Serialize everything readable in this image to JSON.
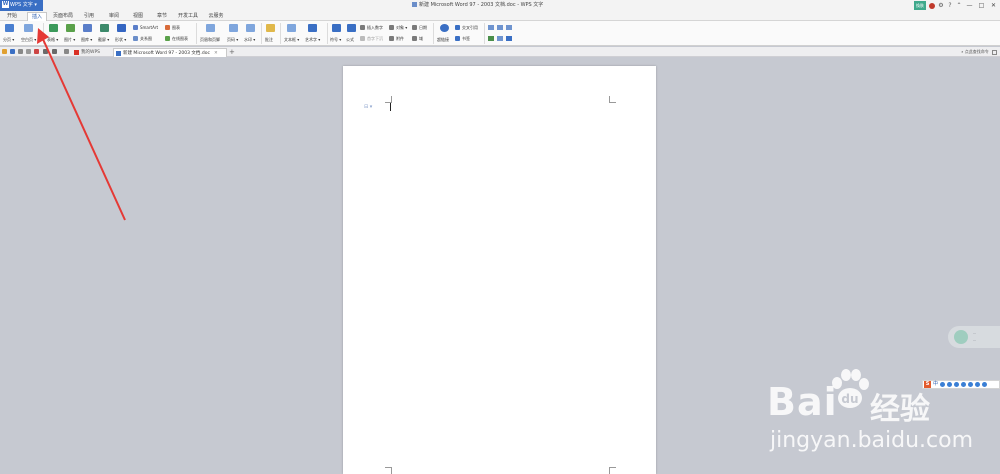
{
  "app": {
    "menu_label": "WPS 文字",
    "logo_letter": "W"
  },
  "window": {
    "title": "新建 Microsoft Word 97 - 2003 文档.doc - WPS 文字",
    "skin_label": "換肤",
    "controls": [
      "—",
      "□",
      "✕"
    ]
  },
  "ribbon_tabs": [
    {
      "label": "开始",
      "active": false
    },
    {
      "label": "插入",
      "active": true
    },
    {
      "label": "页面布局",
      "active": false
    },
    {
      "label": "引用",
      "active": false
    },
    {
      "label": "审阅",
      "active": false
    },
    {
      "label": "视图",
      "active": false
    },
    {
      "label": "章节",
      "active": false
    },
    {
      "label": "开发工具",
      "active": false
    },
    {
      "label": "云服务",
      "active": false
    }
  ],
  "ribbon": {
    "groups": [
      {
        "label": "分页 ▾",
        "icon": "page-break-icon",
        "color": "#4a7fd0"
      },
      {
        "label": "空白页 ▾",
        "icon": "blank-page-icon",
        "color": "#7fa6dd"
      },
      {
        "label": "表格 ▾",
        "icon": "table-icon",
        "color": "#3c9a5b"
      },
      {
        "label": "图片 ▾",
        "icon": "picture-icon",
        "color": "#5aa14a"
      },
      {
        "label": "图库 ▾",
        "icon": "gallery-icon",
        "color": "#5a7ec9"
      },
      {
        "label": "截屏 ▾",
        "icon": "screenshot-icon",
        "color": "#3d8a6b"
      },
      {
        "label": "形状 ▾",
        "icon": "shape-icon",
        "color": "#3566c2"
      }
    ],
    "small_items": [
      {
        "label": "SmartArt",
        "icon": "smartart-icon"
      },
      {
        "label": "图表",
        "icon": "chart-icon"
      },
      {
        "label": "关系图",
        "icon": "relation-icon"
      },
      {
        "label": "在线图表",
        "icon": "online-chart-icon"
      }
    ],
    "groups2": [
      {
        "label": "页眉和页脚",
        "icon": "header-footer-icon",
        "color": "#7fa6dd"
      },
      {
        "label": "页码 ▾",
        "icon": "page-number-icon",
        "color": "#7fa6dd"
      },
      {
        "label": "水印 ▾",
        "icon": "watermark-icon",
        "color": "#7fa6dd"
      },
      {
        "label": "批注",
        "icon": "comment-icon",
        "color": "#e0b84a"
      },
      {
        "label": "文本框 ▾",
        "icon": "textbox-icon",
        "color": "#7fa6dd"
      },
      {
        "label": "艺术字 ▾",
        "icon": "wordart-icon",
        "color": "#3a6fc4"
      },
      {
        "label": "符号 ▾",
        "icon": "symbol-icon",
        "color": "#3a6fc4"
      },
      {
        "label": "公式",
        "icon": "formula-icon",
        "color": "#3a6fc4"
      }
    ],
    "small_items2": [
      {
        "label": "插入数字",
        "icon": "insert-number-icon"
      },
      {
        "label": "对象 ▾",
        "icon": "object-icon"
      },
      {
        "label": "日期",
        "icon": "date-icon"
      },
      {
        "label": "首字下沉",
        "icon": "drop-cap-icon"
      },
      {
        "label": "附件",
        "icon": "attachment-icon"
      },
      {
        "label": "域",
        "icon": "field-icon"
      }
    ],
    "groups3": [
      {
        "label": "超链接",
        "icon": "hyperlink-icon",
        "color": "#3a6fc4"
      }
    ],
    "small_items3": [
      {
        "label": "交叉引用",
        "icon": "cross-ref-icon"
      },
      {
        "label": "书签",
        "icon": "bookmark-icon"
      }
    ]
  },
  "doc_tabs": [
    {
      "label": "我的WPS",
      "active": false
    },
    {
      "label": "新建 Microsoft Word 97 - 2003 文档.doc",
      "active": true
    }
  ],
  "tabbar_right_label": "点此查找命令",
  "document": {
    "paragraph_mark": "⊟ ▾"
  },
  "floating_widget": {
    "line1": "...",
    "line2": "..."
  },
  "ime_bar": {
    "brand": "S",
    "mode": "中"
  },
  "watermark": {
    "brand_text": "Bai",
    "brand_text2": "经验",
    "url": "jingyan.baidu.com"
  },
  "annotation": {
    "color": "#e53935"
  }
}
